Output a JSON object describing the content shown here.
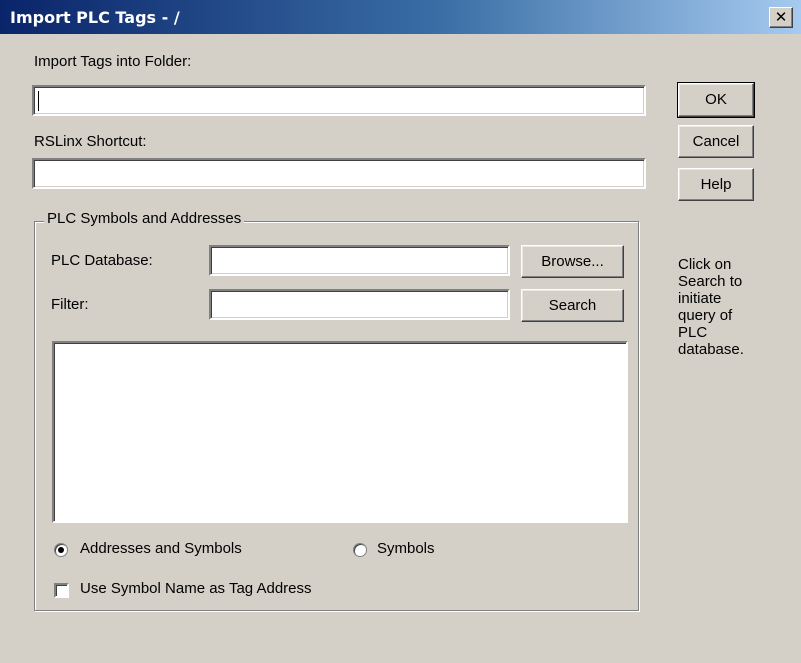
{
  "window": {
    "title": "Import PLC Tags - /",
    "close_glyph": "✕"
  },
  "folder": {
    "label": "Import Tags into Folder:",
    "value": ""
  },
  "shortcut": {
    "label": "RSLinx Shortcut:",
    "value": ""
  },
  "buttons": {
    "ok": "OK",
    "cancel": "Cancel",
    "help": "Help",
    "browse": "Browse...",
    "search": "Search"
  },
  "group": {
    "title": "PLC Symbols and Addresses",
    "database_label": "PLC Database:",
    "database_value": "",
    "filter_label": "Filter:",
    "filter_value": ""
  },
  "results": {
    "items": []
  },
  "mode": {
    "option1": "Addresses and Symbols",
    "option2": "Symbols",
    "selected": "Addresses and Symbols"
  },
  "use_symbol_name": {
    "label": "Use Symbol Name as Tag Address",
    "checked": false
  },
  "hint": {
    "line1": "Click on",
    "line2": "Search to",
    "line3": "initiate",
    "line4": "query of",
    "line5": "PLC",
    "line6": "database."
  }
}
